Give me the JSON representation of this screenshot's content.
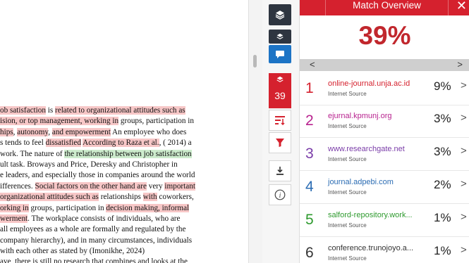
{
  "document": {
    "lines": [
      [
        [
          "hl",
          "ob satisfaction"
        ],
        [
          "",
          " is "
        ],
        [
          "hl",
          "related to organizational attitudes such as"
        ]
      ],
      [
        [
          "hl",
          "ision, or top management, working in"
        ],
        [
          "",
          " groups, participation in"
        ]
      ],
      [
        [
          "hl",
          "hips"
        ],
        [
          "",
          ", "
        ],
        [
          "hl",
          "autonomy"
        ],
        [
          "",
          ", "
        ],
        [
          "hl",
          "and empo"
        ],
        [
          "hl",
          "werment"
        ],
        [
          "",
          " An employee who does"
        ]
      ],
      [
        [
          "",
          "s tends to feel "
        ],
        [
          "hl",
          "dissatisfied"
        ],
        [
          "",
          " "
        ],
        [
          "hl",
          "According to Raza et al."
        ],
        [
          "",
          ", ( 2014) a"
        ]
      ],
      [
        [
          "",
          "work. The nature of "
        ],
        [
          "hg",
          "the relationship between job satisfaction"
        ]
      ],
      [
        [
          "",
          "ult task. Broways and Price, Deresky and Christopher in"
        ]
      ],
      [
        [
          "",
          "e leaders, and especially those in companies around the world"
        ]
      ],
      [
        [
          "",
          "ifferences. "
        ],
        [
          "hl",
          "Social factors on the other hand are"
        ],
        [
          "",
          " very "
        ],
        [
          "hl",
          "important"
        ]
      ],
      [
        [
          "hl",
          "organizational attitudes such as"
        ],
        [
          "",
          " relationships "
        ],
        [
          "hl",
          "with"
        ],
        [
          "",
          " coworkers,"
        ]
      ],
      [
        [
          "hl",
          "orking in"
        ],
        [
          "",
          " groups, participation in "
        ],
        [
          "hl",
          "decision making, informal"
        ]
      ],
      [
        [
          "hl",
          "werment"
        ],
        [
          "",
          ". The workplace consists of individuals, who are"
        ]
      ],
      [
        [
          "",
          "all employees as a whole are formally and regulated by the"
        ]
      ],
      [
        [
          "",
          "company hierarchy), and in many circumstances, individuals"
        ]
      ],
      [
        [
          "",
          "with each other as stated by (Imonikhe, 2024)"
        ]
      ],
      [
        [
          "",
          "ave, there is still no research that combines and looks at the"
        ]
      ]
    ]
  },
  "toolbar": {
    "match_percent": "39"
  },
  "panel": {
    "title": "Match Overview",
    "close": "✕",
    "overall_percent": "39%",
    "pager_prev": "<",
    "pager_next": ">",
    "matches": [
      {
        "rank": "1",
        "source": "online-journal.unja.ac.id",
        "type": "Internet Source",
        "percent": "9%",
        "color": "#d5212e"
      },
      {
        "rank": "2",
        "source": "ejurnal.kpmunj.org",
        "type": "Internet Source",
        "percent": "3%",
        "color": "#b8238f"
      },
      {
        "rank": "3",
        "source": "www.researchgate.net",
        "type": "Internet Source",
        "percent": "3%",
        "color": "#7a3ca8"
      },
      {
        "rank": "4",
        "source": "journal.adpebi.com",
        "type": "Internet Source",
        "percent": "2%",
        "color": "#2b6cb3"
      },
      {
        "rank": "5",
        "source": "salford-repository.work...",
        "type": "Internet Source",
        "percent": "1%",
        "color": "#2e9a2e"
      },
      {
        "rank": "6",
        "source": "conference.trunojoyo.a...",
        "type": "Internet Source",
        "percent": "1%",
        "color": "#333333"
      }
    ]
  }
}
